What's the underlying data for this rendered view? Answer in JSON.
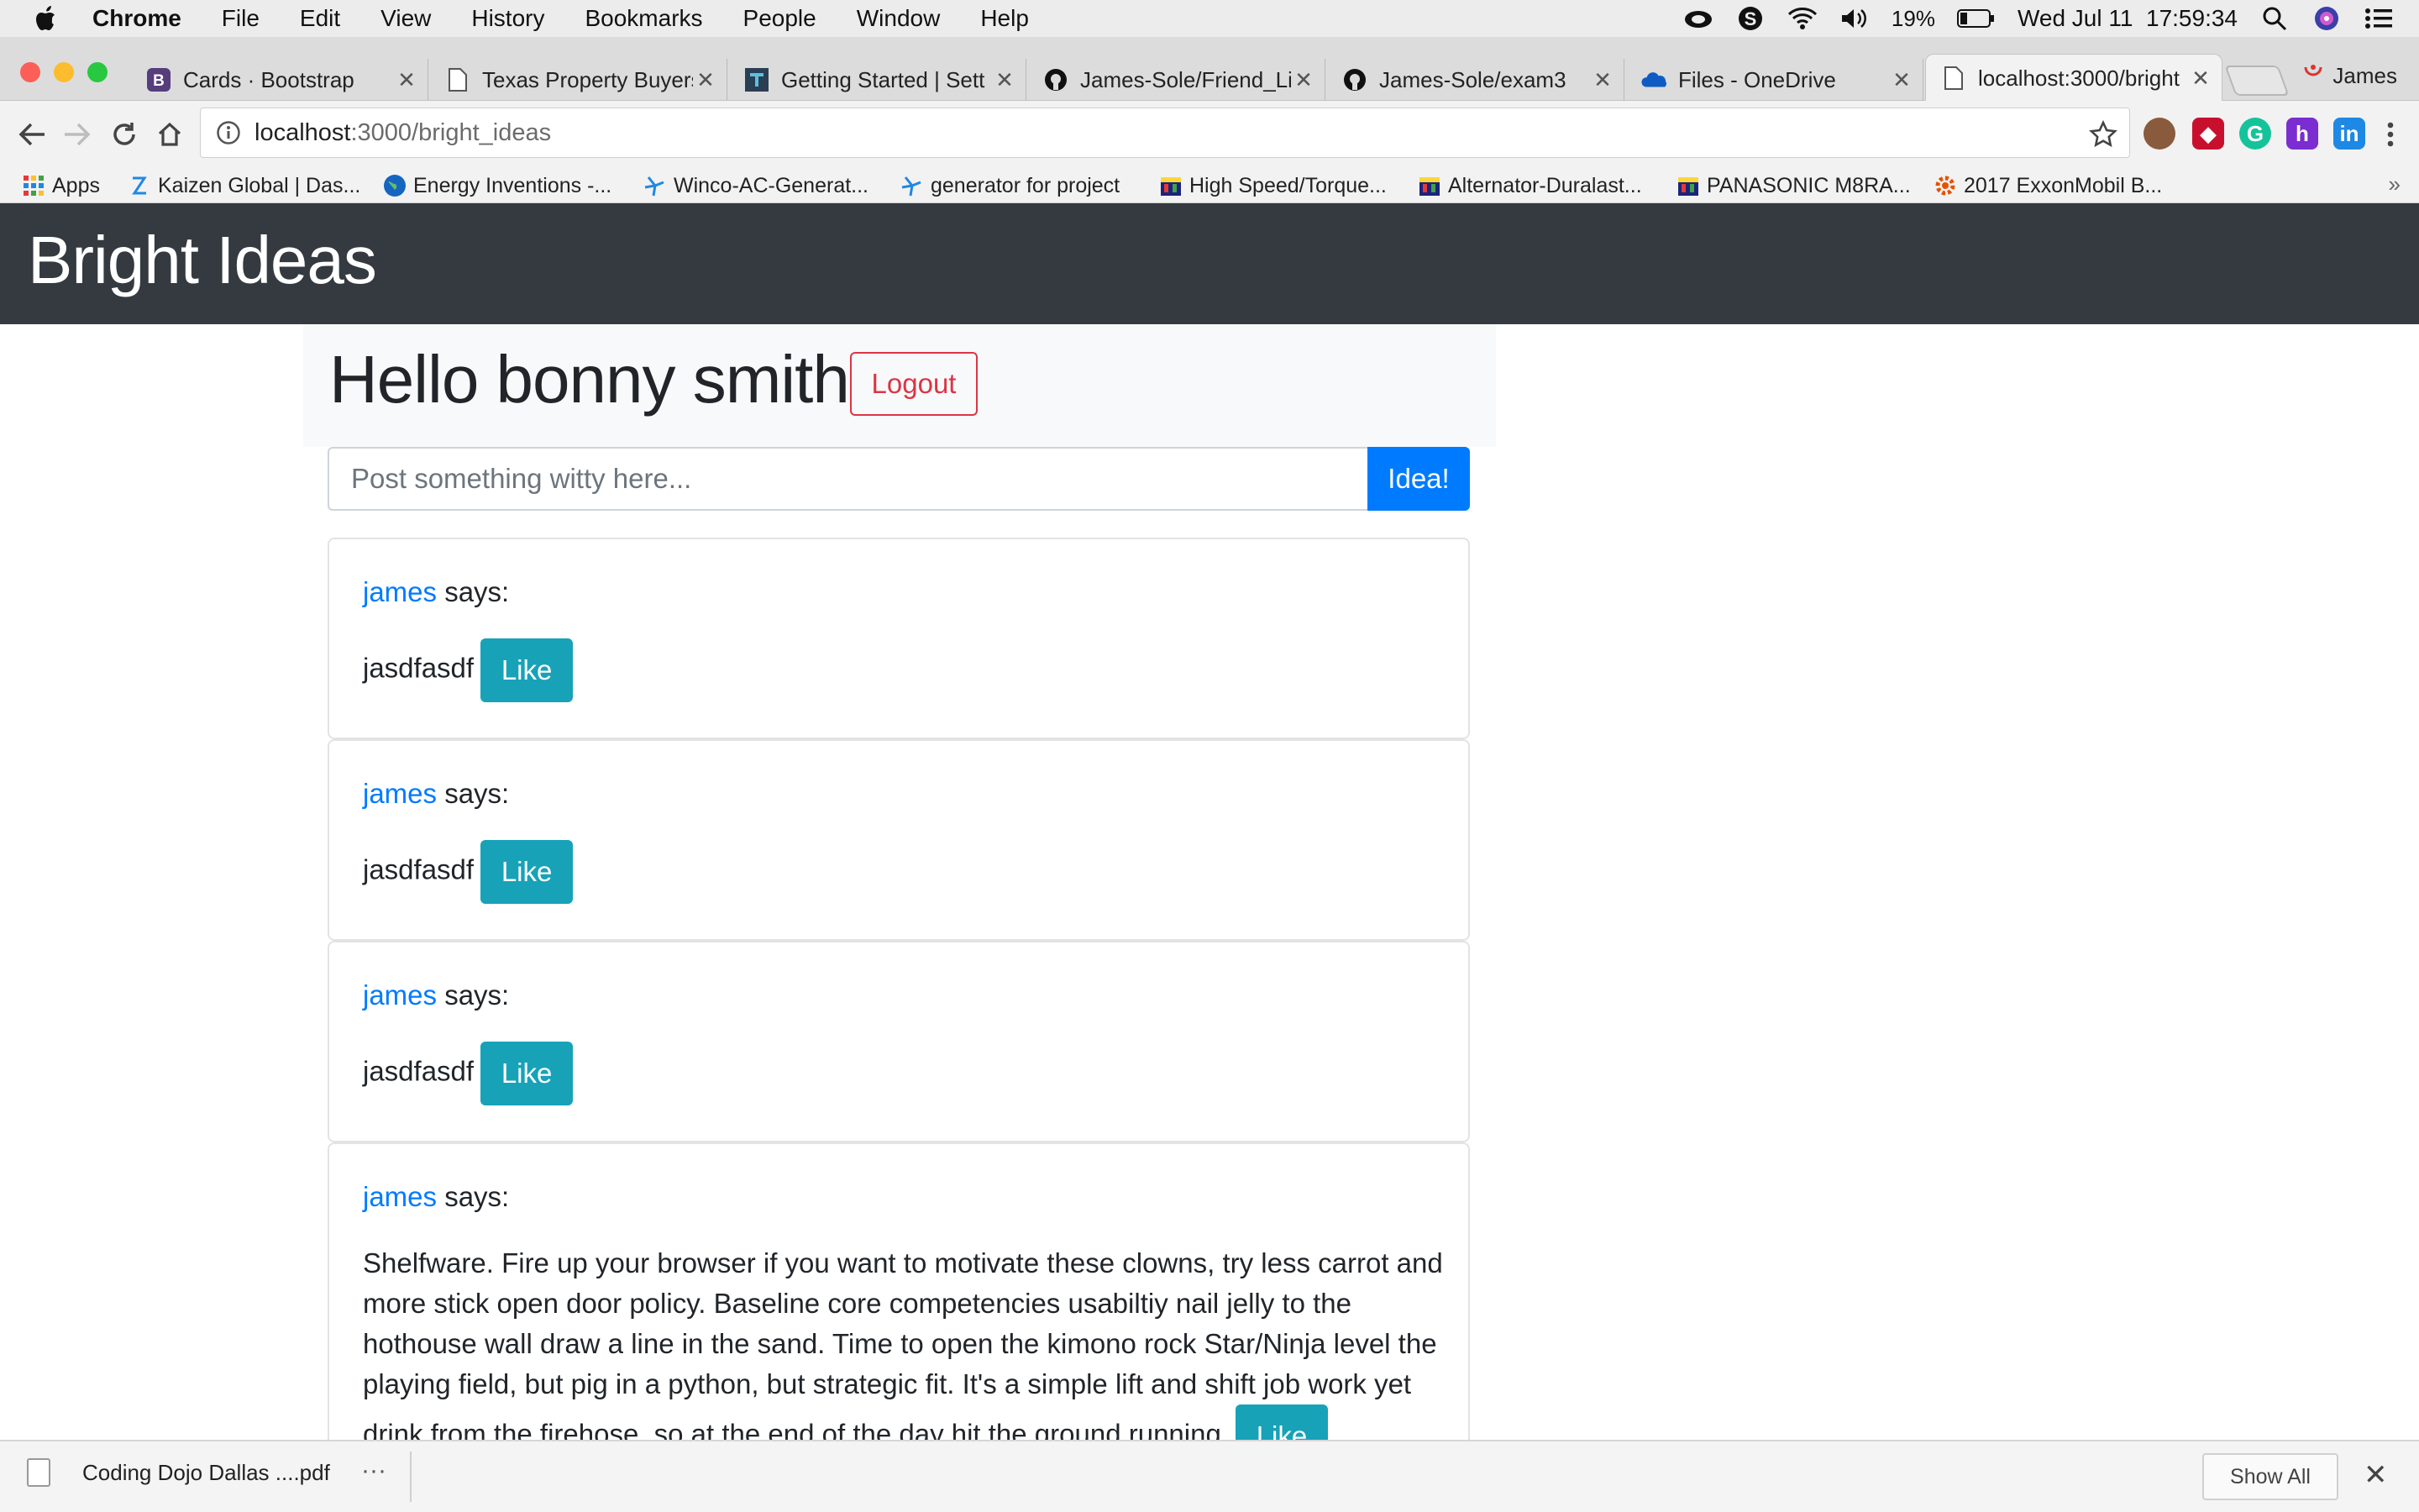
{
  "menubar": {
    "app_name": "Chrome",
    "items": [
      "File",
      "Edit",
      "View",
      "History",
      "Bookmarks",
      "People",
      "Window",
      "Help"
    ],
    "battery": "19%",
    "datetime": "Wed Jul 11  17:59:34"
  },
  "tabs": [
    {
      "title": "Cards · Bootstrap",
      "icon": "bootstrap-icon",
      "active": false
    },
    {
      "title": "Texas Property Buyers",
      "icon": "page-icon",
      "active": false
    },
    {
      "title": "Getting Started | Sett",
      "icon": "docs-icon",
      "active": false
    },
    {
      "title": "James-Sole/Friend_Li",
      "icon": "github-icon",
      "active": false
    },
    {
      "title": "James-Sole/exam3",
      "icon": "github-icon",
      "active": false
    },
    {
      "title": "Files - OneDrive",
      "icon": "onedrive-icon",
      "active": false
    },
    {
      "title": "localhost:3000/bright",
      "icon": "page-icon",
      "active": true
    }
  ],
  "profile_name": "James",
  "address": {
    "host": "localhost",
    "path": ":3000/bright_ideas"
  },
  "bookmarks": [
    {
      "label": "Apps"
    },
    {
      "label": "Kaizen Global | Das..."
    },
    {
      "label": "Energy Inventions -..."
    },
    {
      "label": "Winco-AC-Generat..."
    },
    {
      "label": "generator for project"
    },
    {
      "label": "High Speed/Torque..."
    },
    {
      "label": "Alternator-Duralast..."
    },
    {
      "label": "PANASONIC M8RA..."
    },
    {
      "label": "2017 ExxonMobil B..."
    }
  ],
  "bookmarks_more": "»",
  "page": {
    "site_title": "Bright Ideas",
    "greeting": "Hello bonny smith",
    "logout_label": "Logout",
    "idea_placeholder": "Post something witty here...",
    "idea_button": "Idea!",
    "says_suffix": " says:",
    "like_label": "Like",
    "posts": [
      {
        "author": "james",
        "text": "jasdfasdf"
      },
      {
        "author": "james",
        "text": "jasdfasdf"
      },
      {
        "author": "james",
        "text": "jasdfasdf"
      },
      {
        "author": "james",
        "text": "Shelfware. Fire up your browser if you want to motivate these clowns, try less carrot and more stick open door policy. Baseline core competencies usabiltiy nail jelly to the hothouse wall draw a line in the sand. Time to open the kimono rock Star/Ninja level the playing field, but pig in a python, but strategic fit. It's a simple lift and shift job work yet drink from the firehose, so at the end of the day hit the ground running."
      }
    ]
  },
  "downloads": {
    "file_name": "Coding Dojo Dallas ....pdf",
    "more": "···",
    "show_all": "Show All",
    "close": "✕"
  },
  "colors": {
    "header_bg": "#343a40",
    "primary": "#007bff",
    "danger": "#dc3545",
    "info": "#17a2b8"
  }
}
